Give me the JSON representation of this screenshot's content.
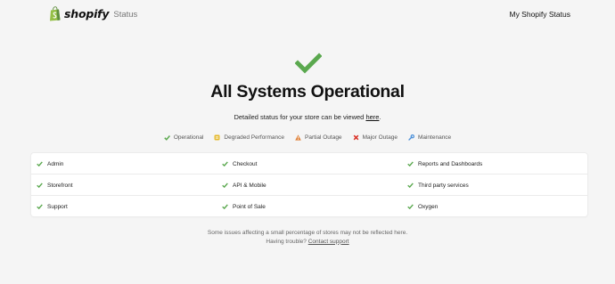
{
  "header": {
    "logo_word": "shopify",
    "logo_suffix": "Status",
    "my_status_link": "My Shopify Status"
  },
  "hero": {
    "icon": "check-icon",
    "title": "All Systems Operational",
    "detail_prefix": "Detailed status for your store can be viewed ",
    "detail_link": "here",
    "detail_suffix": "."
  },
  "legend": [
    {
      "label": "Operational",
      "icon": "check-icon",
      "color": "#5aa84e"
    },
    {
      "label": "Degraded Performance",
      "icon": "degraded-icon",
      "color": "#e5b92c"
    },
    {
      "label": "Partial Outage",
      "icon": "warning-icon",
      "color": "#e0823a"
    },
    {
      "label": "Major Outage",
      "icon": "x-icon",
      "color": "#d93025"
    },
    {
      "label": "Maintenance",
      "icon": "wrench-icon",
      "color": "#4a8fd9"
    }
  ],
  "services": [
    [
      "Admin",
      "Checkout",
      "Reports and Dashboards"
    ],
    [
      "Storefront",
      "API & Mobile",
      "Third party services"
    ],
    [
      "Support",
      "Point of Sale",
      "Oxygen"
    ]
  ],
  "footer": {
    "note": "Some issues affecting a small percentage of stores may not be reflected here.",
    "trouble_prefix": "Having trouble? ",
    "contact_link": "Contact support"
  },
  "colors": {
    "operational": "#5aa84e",
    "background": "#f5f5f5",
    "brand_green": "#95bf47"
  }
}
